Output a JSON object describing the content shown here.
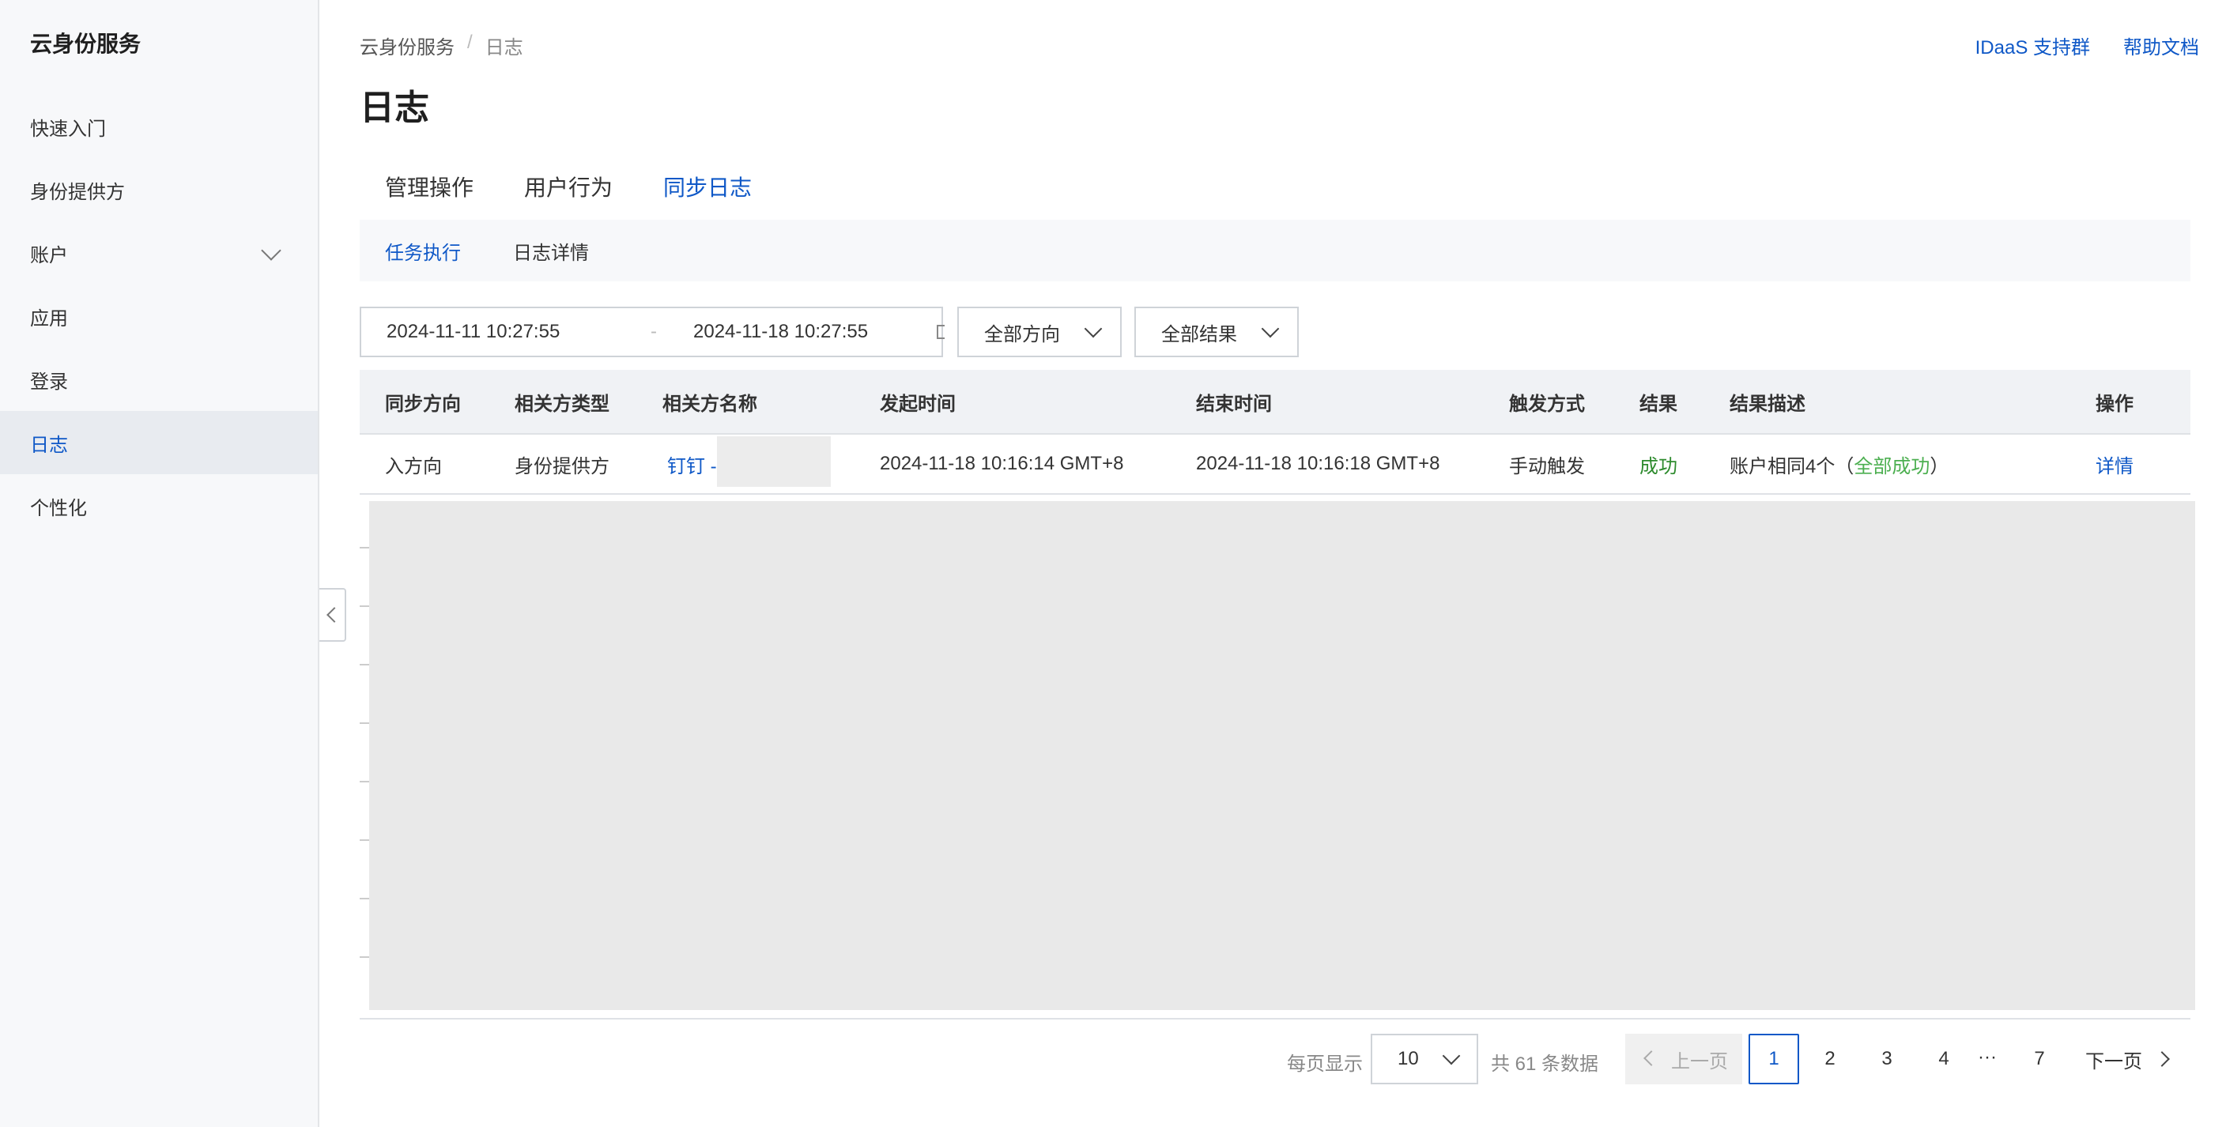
{
  "sidebar": {
    "title": "云身份服务",
    "items": [
      {
        "label": "快速入门"
      },
      {
        "label": "身份提供方"
      },
      {
        "label": "账户"
      },
      {
        "label": "应用"
      },
      {
        "label": "登录"
      },
      {
        "label": "日志"
      },
      {
        "label": "个性化"
      }
    ],
    "active_index": 5
  },
  "header": {
    "breadcrumb": [
      "云身份服务",
      "日志"
    ],
    "links": [
      "IDaaS 支持群",
      "帮助文档"
    ],
    "title": "日志"
  },
  "tabs": [
    "管理操作",
    "用户行为",
    "同步日志"
  ],
  "subtabs": [
    "任务执行",
    "日志详情"
  ],
  "filters": {
    "start_date": "2024-11-11 10:27:55",
    "end_date": "2024-11-18 10:27:55",
    "direction": "全部方向",
    "result": "全部结果"
  },
  "table": {
    "headers": [
      "同步方向",
      "相关方类型",
      "相关方名称",
      "发起时间",
      "结束时间",
      "触发方式",
      "结果",
      "结果描述",
      "操作"
    ],
    "rows": [
      {
        "direction": "入方向",
        "party_type": "身份提供方",
        "party_name": "钉钉 -",
        "start_time": "2024-11-18 10:16:14 GMT+8",
        "end_time": "2024-11-18 10:16:18 GMT+8",
        "trigger": "手动触发",
        "result": "成功",
        "desc_prefix": "账户相同4个（",
        "desc_status": "全部成功",
        "desc_suffix": "）",
        "action": "详情"
      }
    ]
  },
  "pagination": {
    "per_page_label": "每页显示",
    "per_page": "10",
    "total": "共 61 条数据",
    "prev": "上一页",
    "pages": [
      "1",
      "2",
      "3",
      "4",
      "7"
    ],
    "ellipsis": "···",
    "next": "下一页",
    "current": "1"
  },
  "colors": {
    "accent": "#0f58c7",
    "success": "#2e8b2e",
    "sidebar_bg": "#f7f8fa"
  }
}
